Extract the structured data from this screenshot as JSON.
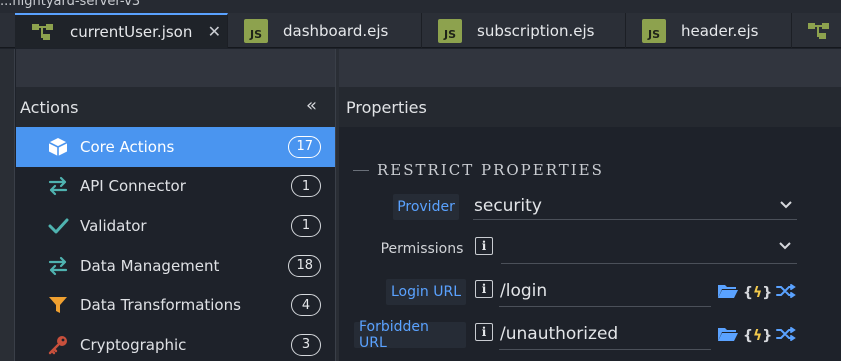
{
  "window": {
    "title": "...nightyard-server-v3"
  },
  "tabs": [
    {
      "label": "currentUser.json",
      "icon": "json-tree-icon",
      "active": true,
      "closable": true
    },
    {
      "label": "dashboard.ejs",
      "icon": "js-file-icon"
    },
    {
      "label": "subscription.ejs",
      "icon": "js-file-icon"
    },
    {
      "label": "header.ejs",
      "icon": "js-file-icon"
    },
    {
      "label": "",
      "icon": "json-tree-icon"
    }
  ],
  "actions": {
    "title": "Actions",
    "collapse_glyph": "«",
    "items": [
      {
        "label": "Core Actions",
        "count": "17",
        "icon": "cube-icon",
        "selected": true
      },
      {
        "label": "API Connector",
        "count": "1",
        "icon": "swap-arrows-icon"
      },
      {
        "label": "Validator",
        "count": "1",
        "icon": "check-icon"
      },
      {
        "label": "Data Management",
        "count": "18",
        "icon": "swap-arrows-icon"
      },
      {
        "label": "Data Transformations",
        "count": "4",
        "icon": "funnel-icon"
      },
      {
        "label": "Cryptographic",
        "count": "3",
        "icon": "key-icon"
      }
    ]
  },
  "properties": {
    "title": "Properties",
    "section": "RESTRICT PROPERTIES",
    "provider": {
      "label": "Provider",
      "value": "security"
    },
    "permissions": {
      "label": "Permissions",
      "value": ""
    },
    "login_url": {
      "label": "Login URL",
      "value": "/login"
    },
    "forbidden_url": {
      "label": "Forbidden URL",
      "value": "/unauthorized"
    }
  },
  "colors": {
    "accent": "#4a95f0",
    "link": "#5aa2ff",
    "js_badge": "#8da24e",
    "folder": "#5aa2ff",
    "bolt": "#f2c94c"
  }
}
